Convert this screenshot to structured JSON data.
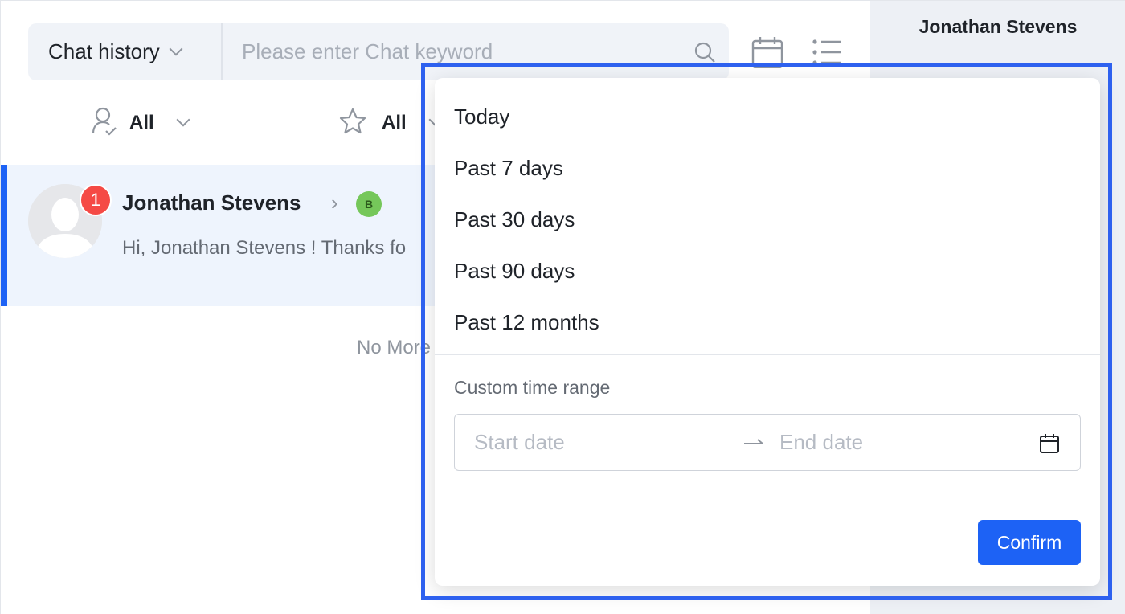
{
  "search": {
    "scope_label": "Chat history",
    "placeholder": "Please enter Chat keyword",
    "value": ""
  },
  "toolbar": {
    "icons": [
      "calendar-icon",
      "list-icon"
    ]
  },
  "filters": [
    {
      "icon": "user-check-icon",
      "label": "All"
    },
    {
      "icon": "star-icon",
      "label": "All"
    }
  ],
  "conversation": {
    "name": "Jonathan Stevens",
    "unread": "1",
    "tag": "B",
    "preview": "Hi, Jonathan Stevens ! Thanks fo"
  },
  "list_end_text": "No More",
  "right_panel": {
    "title": "Jonathan Stevens"
  },
  "date_dropdown": {
    "options": [
      "Today",
      "Past 7 days",
      "Past 30 days",
      "Past 90 days",
      "Past 12 months"
    ],
    "custom_label": "Custom time range",
    "start_placeholder": "Start date",
    "end_placeholder": "End date",
    "confirm_label": "Confirm"
  },
  "colors": {
    "accent": "#1d62f5",
    "badge": "#f54a45",
    "tag": "#75c75a",
    "selected_row": "#eef4fd"
  }
}
